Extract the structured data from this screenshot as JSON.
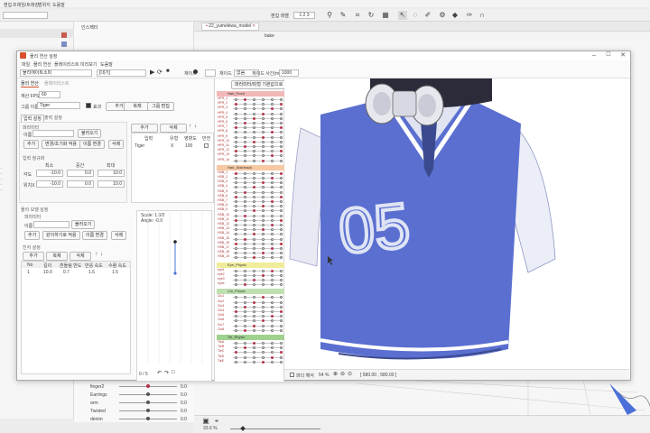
{
  "bg_menu": {
    "items": [
      "편집",
      "프레임/트래킹",
      "범위지",
      "도움말"
    ]
  },
  "bg_toolbar": {
    "mode_label": "편집 레벨",
    "level_values": [
      "1",
      "2",
      "3"
    ]
  },
  "bg_doc": {
    "tab_label": "22_yumekiwa_model",
    "sub_label": "bake",
    "left_panel_label": "인스펙터"
  },
  "bottom_params": {
    "rows": [
      {
        "label": "finger2",
        "value": "0.0"
      },
      {
        "label": "Earrings",
        "value": "0.0"
      },
      {
        "label": "arm",
        "value": "0.0"
      },
      {
        "label": "Twisted",
        "value": "0.0"
      },
      {
        "label": "denim",
        "value": "0.0"
      }
    ],
    "zoom": "33.6 %"
  },
  "window": {
    "title": "물리 연산 설정",
    "menu": [
      "파일",
      "물리 연산",
      "플레이리스트",
      "미리보기",
      "도움말"
    ],
    "scene_select": "물리에이트소피",
    "motion_select": "[대기]",
    "toolbar_labels": [
      "재이드",
      "없음",
      "재이드 사간(ms)"
    ],
    "toolbar_value": "1000",
    "tabs": [
      "물리 연산",
      "플레이리스트"
    ],
    "fps_label": "계산 FPS",
    "fps_value": "60",
    "group_name_label": "그룹 이름",
    "group_name_value": "Tiger",
    "effect_label": "효과",
    "group_buttons": [
      "추가",
      "복제",
      "그룹 편집"
    ],
    "input_tabs": [
      "입력 설정",
      "출력 설정"
    ],
    "output_tabs": [
      "추가",
      "삭제"
    ],
    "param_section": {
      "title": "파라미터",
      "name_label": "이름",
      "name_value": "",
      "buttons": [
        "불러오기",
        "추가",
        "변경/초기화 적용",
        "이름 변경",
        "삭제"
      ]
    },
    "input_table": {
      "headers": [
        "입력",
        "유형",
        "영향도",
        "반전"
      ],
      "row": [
        "Tiger",
        "X",
        "100",
        ""
      ]
    },
    "normalize": {
      "title": "입력 정규화",
      "headers": [
        "최소",
        "중간",
        "최대"
      ],
      "rows": [
        {
          "label": "각도",
          "min": "-10.0",
          "mid": "0.0",
          "max": "10.0"
        },
        {
          "label": "위치X",
          "min": "-10.0",
          "mid": "0.0",
          "max": "10.0"
        }
      ]
    },
    "physics_model": {
      "title": "물리 모델 설정",
      "sub_title": "파라미터",
      "name_label": "이름",
      "buttons": [
        "불러오기",
        "추가",
        "같이하기로 적용",
        "이름 변경",
        "삭제"
      ]
    },
    "pendulum": {
      "title": "진자 설정",
      "buttons": [
        "추가",
        "복제",
        "삭제"
      ],
      "headers": [
        "No",
        "길이",
        "흔들림 반도",
        "반응 속도",
        "수렴 속도"
      ],
      "row": [
        "1",
        "10.0",
        "0.7",
        "1.6",
        "1.5"
      ]
    },
    "preview": {
      "scale": "Scale: 1.0/2",
      "angle": "Angle: -0.0"
    },
    "graph_footer": "0 / 5",
    "param_panel": {
      "header_button": "파라미터/파형 기본값으로 복원",
      "groups": [
        {
          "name": "Hair_Front",
          "color": "#f2b7b7",
          "rows": [
            "HFR_1",
            "HFR_2",
            "HFR_3",
            "HFR_4",
            "HFR_5",
            "HFR_6",
            "HFR_7",
            "HFR_8",
            "HFR_9",
            "HFR_10",
            "HFR_11",
            "HFR_12",
            "HFR_13",
            "HFR_14"
          ]
        },
        {
          "name": "Hair_Side/back",
          "color": "#f6c9a4",
          "rows": [
            "HSB_1",
            "HSB_2",
            "HSB_3",
            "HSB_4",
            "HSB_5",
            "HSB_6",
            "HSB_7",
            "HSB_8",
            "HSB_9",
            "HSB_10",
            "HSB_11",
            "HSB_12",
            "HSB_13",
            "HSB_14",
            "HSB_15",
            "HSB_16",
            "HSB_17",
            "HSB_18",
            "HSB_19"
          ]
        },
        {
          "name": "Eye_Physic",
          "color": "#f1ec9a",
          "rows": [
            "eye1",
            "eye2",
            "eye3",
            "eye4"
          ]
        },
        {
          "name": "Clo_Physic",
          "color": "#bfe0b0",
          "rows": [
            "Clo1",
            "Clo2",
            "Clo3",
            "Clo4",
            "Clo5",
            "Clo6",
            "Clo7",
            "Clo8"
          ]
        },
        {
          "name": "Tie_Physic",
          "color": "#9fd18f",
          "rows": [
            "TieA",
            "TieB",
            "TieC",
            "TieD",
            "TieE"
          ]
        }
      ]
    },
    "canvas_footer": {
      "checkbox_label": "파다 해석",
      "zoom": "54 %",
      "coords": "[ 580.00 , 580.00 ]"
    },
    "shirt_text": "05"
  },
  "colors": {
    "accent": "#d9512c",
    "shirt": "#5a6fd0",
    "selection": "#b5334a"
  }
}
